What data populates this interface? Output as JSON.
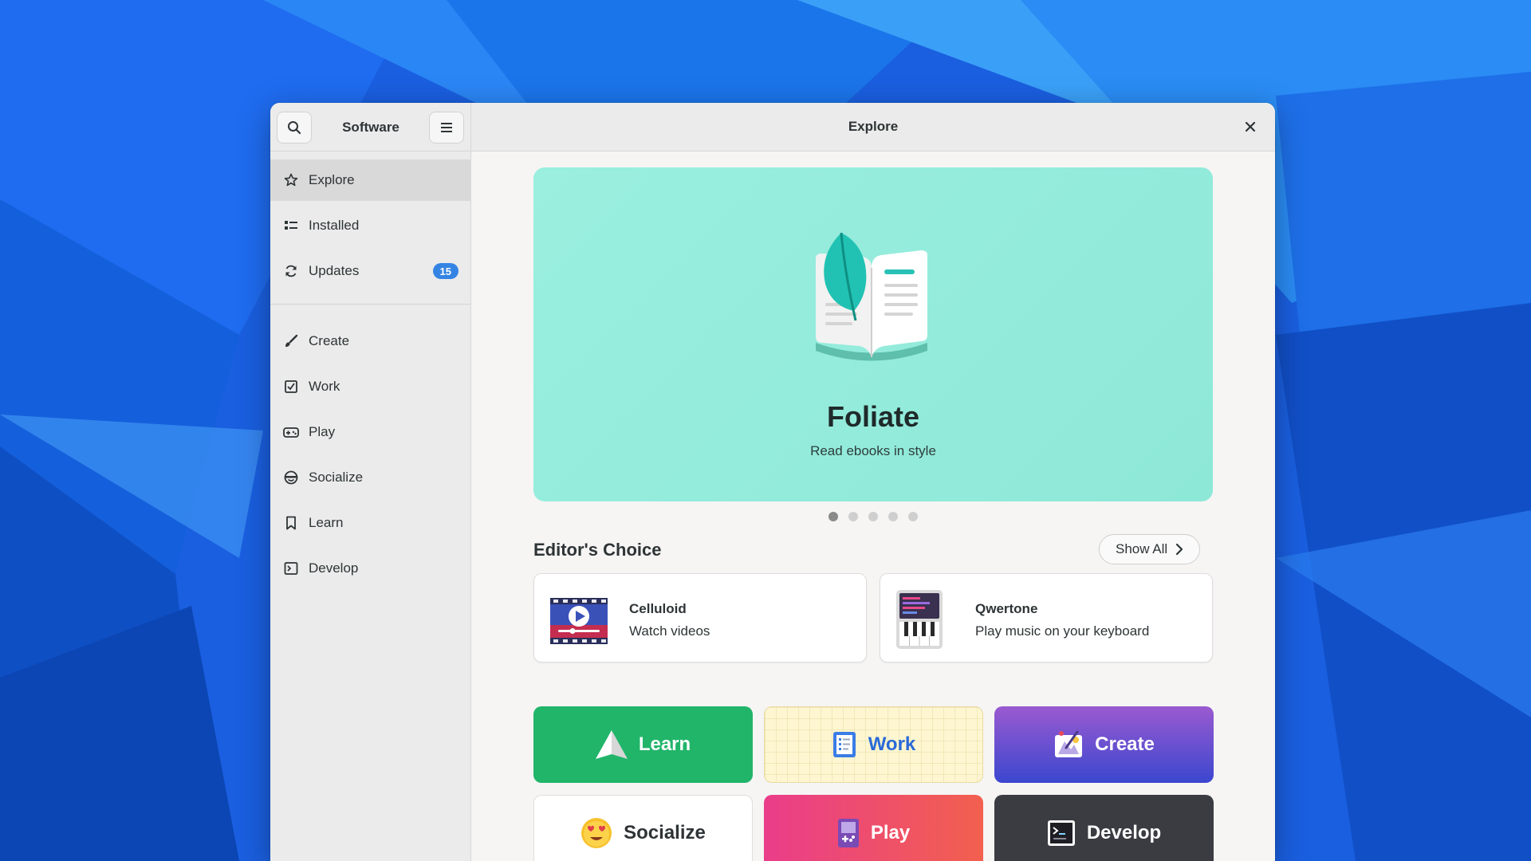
{
  "window": {
    "sidebar_title": "Software",
    "main_title": "Explore"
  },
  "sidebar": {
    "items": [
      {
        "label": "Explore",
        "icon": "star-icon",
        "active": true
      },
      {
        "label": "Installed",
        "icon": "list-icon"
      },
      {
        "label": "Updates",
        "icon": "refresh-icon",
        "badge": "15"
      },
      {
        "label": "Create",
        "icon": "brush-icon"
      },
      {
        "label": "Work",
        "icon": "checkbox-icon"
      },
      {
        "label": "Play",
        "icon": "gamepad-icon"
      },
      {
        "label": "Socialize",
        "icon": "smiley-icon"
      },
      {
        "label": "Learn",
        "icon": "bookmark-icon"
      },
      {
        "label": "Develop",
        "icon": "terminal-icon"
      }
    ]
  },
  "hero": {
    "title": "Foliate",
    "subtitle": "Read ebooks in style",
    "background": "#95ecdc",
    "slides": 5,
    "active_slide": 1
  },
  "editors_choice": {
    "title": "Editor's Choice",
    "show_all": "Show All",
    "apps": [
      {
        "name": "Celluloid",
        "description": "Watch videos",
        "icon": "celluloid-app-icon"
      },
      {
        "name": "Qwertone",
        "description": "Play music on your keyboard",
        "icon": "qwertone-app-icon"
      }
    ]
  },
  "categories": [
    {
      "label": "Learn",
      "icon": "paper-plane-icon",
      "color": "#21b56a"
    },
    {
      "label": "Work",
      "icon": "notepad-icon",
      "color": "#fdf6d0"
    },
    {
      "label": "Create",
      "icon": "palette-icon",
      "color": "#6a50d0"
    },
    {
      "label": "Socialize",
      "icon": "heart-eyes-emoji-icon",
      "color": "#ffffff"
    },
    {
      "label": "Play",
      "icon": "handheld-console-icon",
      "color": "#ee4d6e"
    },
    {
      "label": "Develop",
      "icon": "terminal-app-icon",
      "color": "#3b3b42"
    }
  ],
  "colors": {
    "accent": "#3584e4",
    "wallpaper": "#1556d6"
  }
}
